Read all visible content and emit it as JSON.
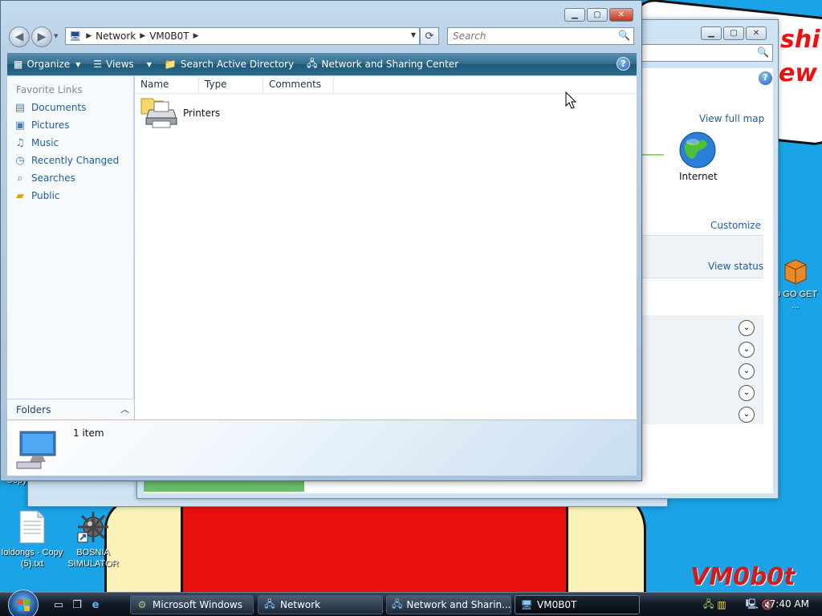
{
  "wallpaper": {
    "scribble_text_1": "shi",
    "scribble_text_2": "ew",
    "signature": "VM0b0t"
  },
  "desktop_icons": [
    {
      "label": "loldongs - Copy (5).txt"
    },
    {
      "label": "BOSNIA SIMULATOR"
    },
    {
      "label": "Copy"
    },
    {
      "label": "O GO GET ..."
    }
  ],
  "network_center_window": {
    "links": {
      "view_full_map": "View full map",
      "customize": "Customize",
      "view_status": "View status"
    },
    "internet_label": "Internet",
    "progress_fraction": 0.5
  },
  "explorer": {
    "breadcrumb": [
      "Network",
      "VM0B0T"
    ],
    "search_placeholder": "Search",
    "toolbar": {
      "organize": "Organize",
      "views": "Views",
      "search_ad": "Search Active Directory",
      "network_sharing": "Network and Sharing Center"
    },
    "nav": {
      "title": "Favorite Links",
      "items": [
        {
          "label": "Documents",
          "icon": "documents-icon"
        },
        {
          "label": "Pictures",
          "icon": "pictures-icon"
        },
        {
          "label": "Music",
          "icon": "music-icon"
        },
        {
          "label": "Recently Changed",
          "icon": "recent-icon"
        },
        {
          "label": "Searches",
          "icon": "searches-icon"
        },
        {
          "label": "Public",
          "icon": "public-folder-icon"
        }
      ],
      "folders_label": "Folders"
    },
    "columns": [
      "Name",
      "Type",
      "Comments"
    ],
    "items": [
      {
        "name": "Printers",
        "icon": "printers-icon"
      }
    ],
    "status": "1 item"
  },
  "taskbar": {
    "buttons": [
      {
        "label": "Microsoft Windows",
        "active": false
      },
      {
        "label": "Network",
        "active": false
      },
      {
        "label": "Network and Sharin...",
        "active": false
      },
      {
        "label": "VM0B0T",
        "active": true
      }
    ],
    "clock": "7:40 AM"
  }
}
